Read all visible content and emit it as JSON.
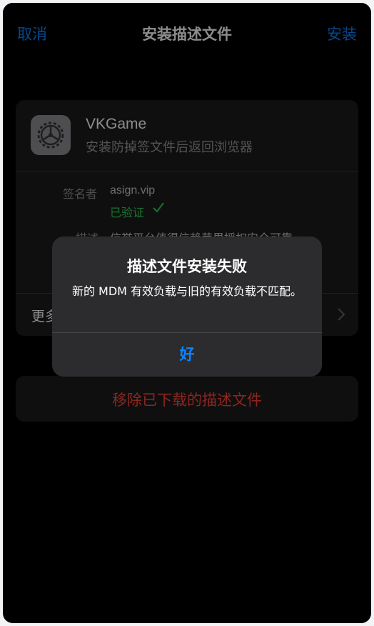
{
  "nav": {
    "cancel": "取消",
    "title": "安装描述文件",
    "install": "安装"
  },
  "profile": {
    "name": "VKGame",
    "subtitle": "安装防掉签文件后返回浏览器",
    "signer_label": "签名者",
    "signer_value": "asign.vip",
    "verified": "已验证",
    "desc_label": "描述",
    "desc_value": "信誉平台值得信赖苹果授权安全可靠",
    "more_label": "更多详细信息",
    "icon": "settings-gear-icon"
  },
  "remove": {
    "label": "移除已下载的描述文件"
  },
  "alert": {
    "title": "描述文件安装失败",
    "message": "新的 MDM 有效负载与旧的有效负载不匹配。",
    "ok": "好"
  },
  "colors": {
    "accent": "#0a84ff",
    "destructive": "#ff453a",
    "verified": "#30d158"
  }
}
